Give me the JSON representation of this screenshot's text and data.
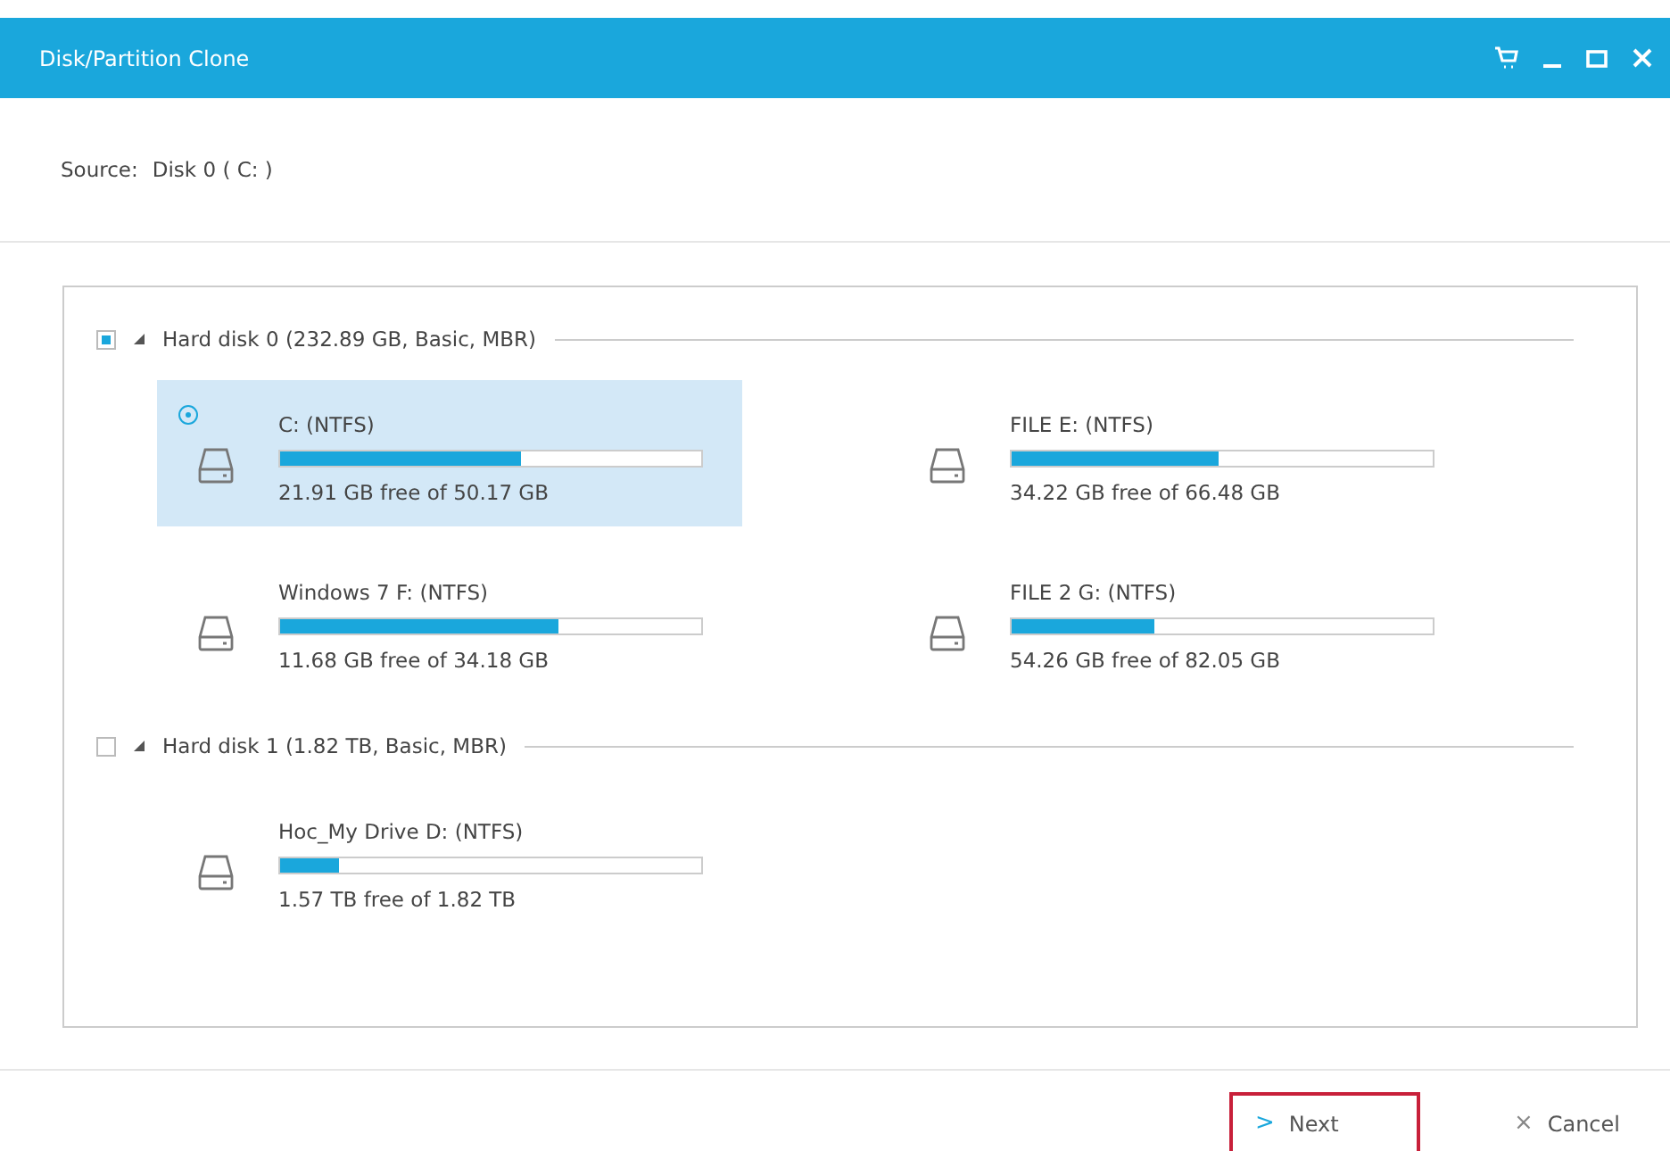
{
  "window": {
    "title": "Disk/Partition Clone"
  },
  "source": {
    "label": "Source:",
    "value": "Disk 0 ( C: )"
  },
  "disks": [
    {
      "label": "Hard disk 0 (232.89 GB, Basic, MBR)",
      "checked": true,
      "partitions": [
        {
          "name": "C: (NTFS)",
          "level": 0.57,
          "reading": "21.91 GB free of 50.17 GB",
          "selected": true
        },
        {
          "name": "FILE E: (NTFS)",
          "level": 0.49,
          "reading": "34.22 GB free of 66.48 GB",
          "selected": false
        },
        {
          "name": "Windows 7 F: (NTFS)",
          "level": 0.66,
          "reading": "11.68 GB free of 34.18 GB",
          "selected": false
        },
        {
          "name": "FILE 2 G: (NTFS)",
          "level": 0.34,
          "reading": "54.26 GB free of 82.05 GB",
          "selected": false
        }
      ]
    },
    {
      "label": "Hard disk 1 (1.82 TB, Basic, MBR)",
      "checked": false,
      "partitions": [
        {
          "name": "Hoc_My Drive D: (NTFS)",
          "level": 0.14,
          "reading": "1.57 TB free of 1.82 TB",
          "selected": false
        }
      ]
    }
  ],
  "buttons": [
    {
      "kind": "next",
      "label": "Next",
      "icon": ">"
    },
    {
      "kind": "cancel",
      "label": "Cancel",
      "icon": "×"
    }
  ]
}
